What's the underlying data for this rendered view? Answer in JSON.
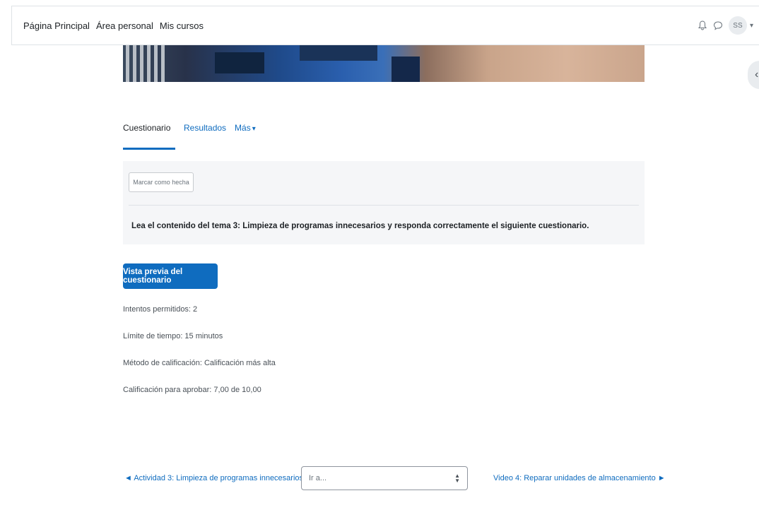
{
  "navbar": {
    "links": [
      "Página Principal",
      "Área personal",
      "Mis cursos"
    ],
    "avatar_initials": "SS",
    "icons": [
      "bell-icon",
      "chat-icon"
    ]
  },
  "tabs": [
    {
      "label": "Cuestionario",
      "active": true
    },
    {
      "label": "Resultados",
      "active": false
    },
    {
      "label": "Más",
      "active": false
    }
  ],
  "activity": {
    "mark_done_label": "Marcar como hecha",
    "description": "Lea el contenido del tema 3: Limpieza de programas innecesarios y responda correctamente el siguiente cuestionario."
  },
  "preview_button": "Vista previa del cuestionario",
  "quiz_info": [
    "Intentos permitidos: 2",
    "Límite de tiempo: 15 minutos",
    "Método de calificación: Calificación más alta",
    "Calificación para aprobar: 7,00 de 10,00"
  ],
  "activity_nav": {
    "prev": "◄ Actividad 3: Limpieza de programas innecesarios",
    "jump_placeholder": "Ir a...",
    "next": "Video 4: Reparar unidades de almacenamiento ►"
  },
  "colors": {
    "primary": "#0f6cbf",
    "panel_bg": "#f5f6f8"
  }
}
